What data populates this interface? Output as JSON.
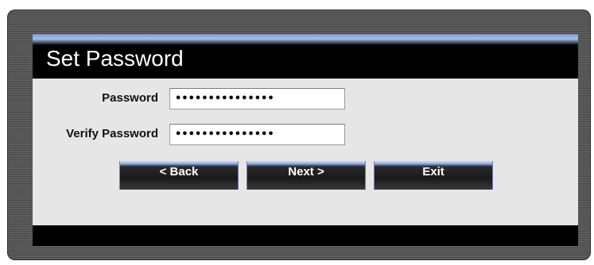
{
  "dialog": {
    "title": "Set Password"
  },
  "form": {
    "password_label": "Password",
    "password_value": "•••••••••••••••",
    "verify_label": "Verify Password",
    "verify_value": "•••••••••••••••"
  },
  "buttons": {
    "back_label": "< Back",
    "next_label": "Next >",
    "exit_label": "Exit"
  },
  "colors": {
    "panel_background": "#e6e6e6",
    "title_bar": "#000000",
    "title_accent": "#a9c0ea",
    "button_face": "#1a1a1a",
    "button_highlight": "#9db6e6"
  }
}
